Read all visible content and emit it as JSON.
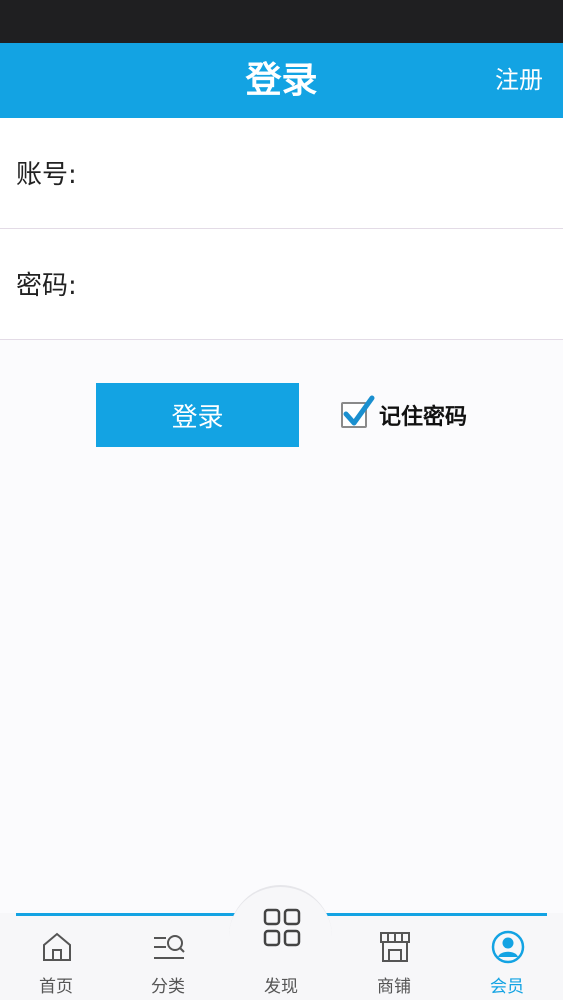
{
  "header": {
    "title": "登录",
    "register_label": "注册"
  },
  "form": {
    "account_label": "账号:",
    "account_value": "",
    "password_label": "密码:",
    "password_value": ""
  },
  "actions": {
    "login_label": "登录",
    "remember_label": "记住密码",
    "remember_checked": true
  },
  "tab_bar": {
    "active": "会员",
    "items": [
      {
        "label": "首页",
        "icon": "home-icon"
      },
      {
        "label": "分类",
        "icon": "category-icon"
      },
      {
        "label": "发现",
        "icon": "discover-grid-icon"
      },
      {
        "label": "商铺",
        "icon": "shop-icon"
      },
      {
        "label": "会员",
        "icon": "member-icon"
      }
    ]
  },
  "colors": {
    "accent": "#13a3e3",
    "status_bar": "#1f1f21",
    "background": "#fbfbfd"
  }
}
